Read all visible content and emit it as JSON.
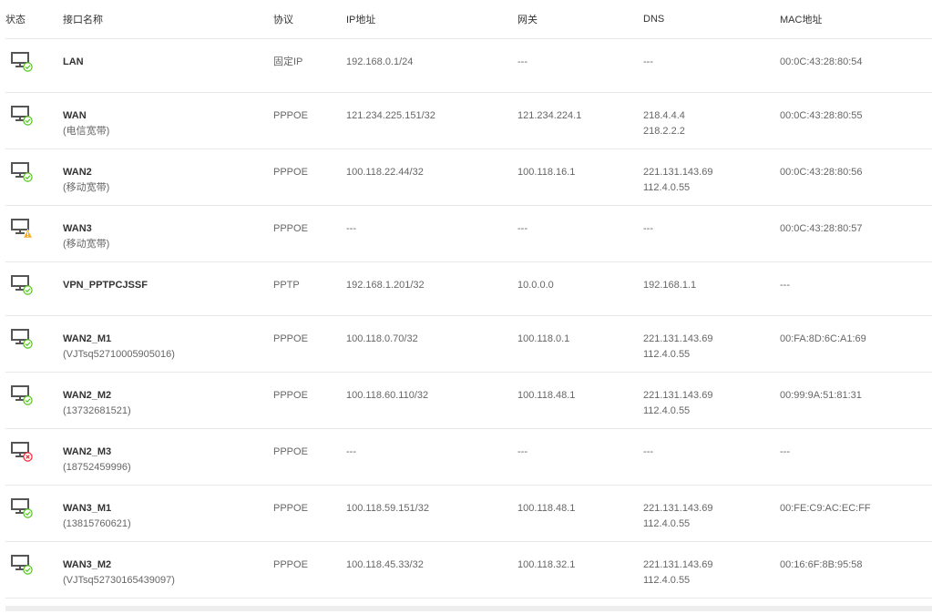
{
  "table": {
    "headers": {
      "status": "状态",
      "name": "接口名称",
      "protocol": "协议",
      "ip": "IP地址",
      "gateway": "网关",
      "dns": "DNS",
      "mac": "MAC地址"
    },
    "rows": [
      {
        "status": "ok",
        "name": "LAN",
        "sub": "",
        "protocol": "固定IP",
        "ip": "192.168.0.1/24",
        "gateway": "---",
        "dns1": "---",
        "dns2": "",
        "mac": "00:0C:43:28:80:54"
      },
      {
        "status": "ok",
        "name": "WAN",
        "sub": "(电信宽带)",
        "protocol": "PPPOE",
        "ip": "121.234.225.151/32",
        "gateway": "121.234.224.1",
        "dns1": "218.4.4.4",
        "dns2": "218.2.2.2",
        "mac": "00:0C:43:28:80:55"
      },
      {
        "status": "ok",
        "name": "WAN2",
        "sub": "(移动宽带)",
        "protocol": "PPPOE",
        "ip": "100.118.22.44/32",
        "gateway": "100.118.16.1",
        "dns1": "221.131.143.69",
        "dns2": "112.4.0.55",
        "mac": "00:0C:43:28:80:56"
      },
      {
        "status": "warning",
        "name": "WAN3",
        "sub": "(移动宽带)",
        "protocol": "PPPOE",
        "ip": "---",
        "gateway": "---",
        "dns1": "---",
        "dns2": "",
        "mac": "00:0C:43:28:80:57"
      },
      {
        "status": "ok",
        "name": "VPN_PPTPCJSSF",
        "sub": "",
        "protocol": "PPTP",
        "ip": "192.168.1.201/32",
        "gateway": "10.0.0.0",
        "dns1": "192.168.1.1",
        "dns2": "",
        "mac": "---"
      },
      {
        "status": "ok",
        "name": "WAN2_M1",
        "sub": "(VJTsq52710005905016)",
        "protocol": "PPPOE",
        "ip": "100.118.0.70/32",
        "gateway": "100.118.0.1",
        "dns1": "221.131.143.69",
        "dns2": "112.4.0.55",
        "mac": "00:FA:8D:6C:A1:69"
      },
      {
        "status": "ok",
        "name": "WAN2_M2",
        "sub": "(13732681521)",
        "protocol": "PPPOE",
        "ip": "100.118.60.110/32",
        "gateway": "100.118.48.1",
        "dns1": "221.131.143.69",
        "dns2": "112.4.0.55",
        "mac": "00:99:9A:51:81:31"
      },
      {
        "status": "error",
        "name": "WAN2_M3",
        "sub": "(18752459996)",
        "protocol": "PPPOE",
        "ip": "---",
        "gateway": "---",
        "dns1": "---",
        "dns2": "",
        "mac": "---"
      },
      {
        "status": "ok",
        "name": "WAN3_M1",
        "sub": "(13815760621)",
        "protocol": "PPPOE",
        "ip": "100.118.59.151/32",
        "gateway": "100.118.48.1",
        "dns1": "221.131.143.69",
        "dns2": "112.4.0.55",
        "mac": "00:FE:C9:AC:EC:FF"
      },
      {
        "status": "ok",
        "name": "WAN3_M2",
        "sub": "(VJTsq52730165439097)",
        "protocol": "PPPOE",
        "ip": "100.118.45.33/32",
        "gateway": "100.118.32.1",
        "dns1": "221.131.143.69",
        "dns2": "112.4.0.55",
        "mac": "00:16:6F:8B:95:58"
      }
    ]
  },
  "status_icons": {
    "ok": {
      "icon": "check-circle-icon",
      "color": "#52c41a"
    },
    "warning": {
      "icon": "warning-triangle-icon",
      "color": "#faad14"
    },
    "error": {
      "icon": "error-circle-icon",
      "color": "#f5222d"
    }
  },
  "monitor_color": "#555555"
}
